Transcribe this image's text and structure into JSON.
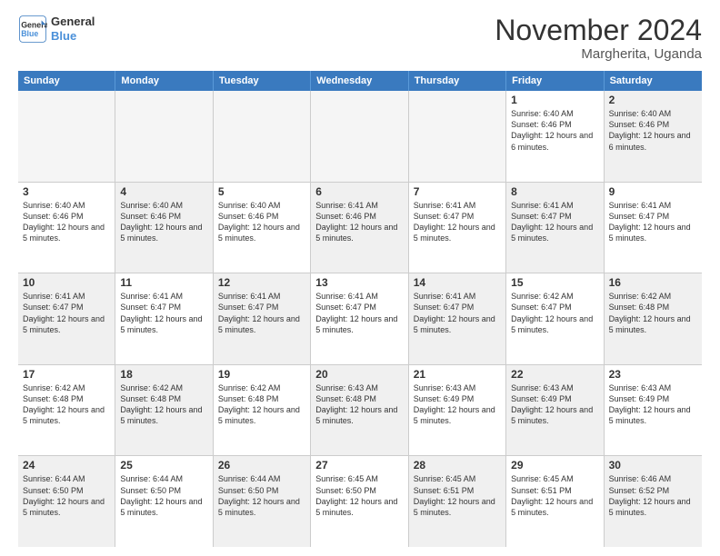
{
  "logo": {
    "text1": "General",
    "text2": "Blue"
  },
  "title": "November 2024",
  "subtitle": "Margherita, Uganda",
  "header": {
    "days": [
      "Sunday",
      "Monday",
      "Tuesday",
      "Wednesday",
      "Thursday",
      "Friday",
      "Saturday"
    ]
  },
  "rows": [
    {
      "cells": [
        {
          "day": "",
          "info": "",
          "empty": true
        },
        {
          "day": "",
          "info": "",
          "empty": true
        },
        {
          "day": "",
          "info": "",
          "empty": true
        },
        {
          "day": "",
          "info": "",
          "empty": true
        },
        {
          "day": "",
          "info": "",
          "empty": true
        },
        {
          "day": "1",
          "info": "Sunrise: 6:40 AM\nSunset: 6:46 PM\nDaylight: 12 hours and 6 minutes.",
          "alt": false
        },
        {
          "day": "2",
          "info": "Sunrise: 6:40 AM\nSunset: 6:46 PM\nDaylight: 12 hours and 6 minutes.",
          "alt": true
        }
      ]
    },
    {
      "cells": [
        {
          "day": "3",
          "info": "Sunrise: 6:40 AM\nSunset: 6:46 PM\nDaylight: 12 hours and 5 minutes.",
          "alt": false
        },
        {
          "day": "4",
          "info": "Sunrise: 6:40 AM\nSunset: 6:46 PM\nDaylight: 12 hours and 5 minutes.",
          "alt": true
        },
        {
          "day": "5",
          "info": "Sunrise: 6:40 AM\nSunset: 6:46 PM\nDaylight: 12 hours and 5 minutes.",
          "alt": false
        },
        {
          "day": "6",
          "info": "Sunrise: 6:41 AM\nSunset: 6:46 PM\nDaylight: 12 hours and 5 minutes.",
          "alt": true
        },
        {
          "day": "7",
          "info": "Sunrise: 6:41 AM\nSunset: 6:47 PM\nDaylight: 12 hours and 5 minutes.",
          "alt": false
        },
        {
          "day": "8",
          "info": "Sunrise: 6:41 AM\nSunset: 6:47 PM\nDaylight: 12 hours and 5 minutes.",
          "alt": true
        },
        {
          "day": "9",
          "info": "Sunrise: 6:41 AM\nSunset: 6:47 PM\nDaylight: 12 hours and 5 minutes.",
          "alt": false
        }
      ]
    },
    {
      "cells": [
        {
          "day": "10",
          "info": "Sunrise: 6:41 AM\nSunset: 6:47 PM\nDaylight: 12 hours and 5 minutes.",
          "alt": true
        },
        {
          "day": "11",
          "info": "Sunrise: 6:41 AM\nSunset: 6:47 PM\nDaylight: 12 hours and 5 minutes.",
          "alt": false
        },
        {
          "day": "12",
          "info": "Sunrise: 6:41 AM\nSunset: 6:47 PM\nDaylight: 12 hours and 5 minutes.",
          "alt": true
        },
        {
          "day": "13",
          "info": "Sunrise: 6:41 AM\nSunset: 6:47 PM\nDaylight: 12 hours and 5 minutes.",
          "alt": false
        },
        {
          "day": "14",
          "info": "Sunrise: 6:41 AM\nSunset: 6:47 PM\nDaylight: 12 hours and 5 minutes.",
          "alt": true
        },
        {
          "day": "15",
          "info": "Sunrise: 6:42 AM\nSunset: 6:47 PM\nDaylight: 12 hours and 5 minutes.",
          "alt": false
        },
        {
          "day": "16",
          "info": "Sunrise: 6:42 AM\nSunset: 6:48 PM\nDaylight: 12 hours and 5 minutes.",
          "alt": true
        }
      ]
    },
    {
      "cells": [
        {
          "day": "17",
          "info": "Sunrise: 6:42 AM\nSunset: 6:48 PM\nDaylight: 12 hours and 5 minutes.",
          "alt": false
        },
        {
          "day": "18",
          "info": "Sunrise: 6:42 AM\nSunset: 6:48 PM\nDaylight: 12 hours and 5 minutes.",
          "alt": true
        },
        {
          "day": "19",
          "info": "Sunrise: 6:42 AM\nSunset: 6:48 PM\nDaylight: 12 hours and 5 minutes.",
          "alt": false
        },
        {
          "day": "20",
          "info": "Sunrise: 6:43 AM\nSunset: 6:48 PM\nDaylight: 12 hours and 5 minutes.",
          "alt": true
        },
        {
          "day": "21",
          "info": "Sunrise: 6:43 AM\nSunset: 6:49 PM\nDaylight: 12 hours and 5 minutes.",
          "alt": false
        },
        {
          "day": "22",
          "info": "Sunrise: 6:43 AM\nSunset: 6:49 PM\nDaylight: 12 hours and 5 minutes.",
          "alt": true
        },
        {
          "day": "23",
          "info": "Sunrise: 6:43 AM\nSunset: 6:49 PM\nDaylight: 12 hours and 5 minutes.",
          "alt": false
        }
      ]
    },
    {
      "cells": [
        {
          "day": "24",
          "info": "Sunrise: 6:44 AM\nSunset: 6:50 PM\nDaylight: 12 hours and 5 minutes.",
          "alt": true
        },
        {
          "day": "25",
          "info": "Sunrise: 6:44 AM\nSunset: 6:50 PM\nDaylight: 12 hours and 5 minutes.",
          "alt": false
        },
        {
          "day": "26",
          "info": "Sunrise: 6:44 AM\nSunset: 6:50 PM\nDaylight: 12 hours and 5 minutes.",
          "alt": true
        },
        {
          "day": "27",
          "info": "Sunrise: 6:45 AM\nSunset: 6:50 PM\nDaylight: 12 hours and 5 minutes.",
          "alt": false
        },
        {
          "day": "28",
          "info": "Sunrise: 6:45 AM\nSunset: 6:51 PM\nDaylight: 12 hours and 5 minutes.",
          "alt": true
        },
        {
          "day": "29",
          "info": "Sunrise: 6:45 AM\nSunset: 6:51 PM\nDaylight: 12 hours and 5 minutes.",
          "alt": false
        },
        {
          "day": "30",
          "info": "Sunrise: 6:46 AM\nSunset: 6:52 PM\nDaylight: 12 hours and 5 minutes.",
          "alt": true
        }
      ]
    }
  ]
}
